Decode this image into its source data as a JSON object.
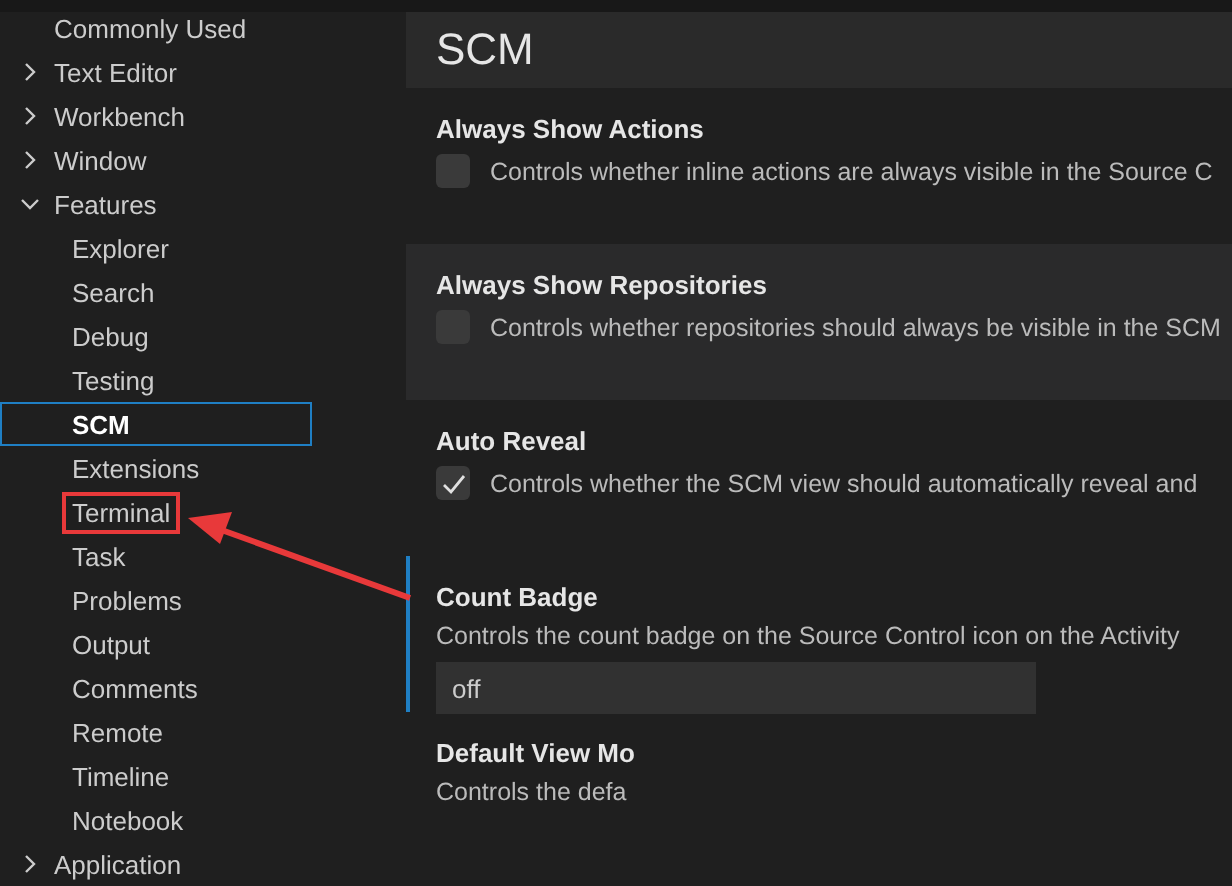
{
  "sidebar": {
    "items": [
      {
        "label": "Commonly Used",
        "kind": "link",
        "selected": false
      },
      {
        "label": "Text Editor",
        "kind": "group",
        "expanded": false,
        "selected": false
      },
      {
        "label": "Workbench",
        "kind": "group",
        "expanded": false,
        "selected": false
      },
      {
        "label": "Window",
        "kind": "group",
        "expanded": false,
        "selected": false
      },
      {
        "label": "Features",
        "kind": "group",
        "expanded": true,
        "selected": false,
        "children": [
          {
            "label": "Explorer",
            "selected": false,
            "highlighted": false
          },
          {
            "label": "Search",
            "selected": false,
            "highlighted": false
          },
          {
            "label": "Debug",
            "selected": false,
            "highlighted": false
          },
          {
            "label": "Testing",
            "selected": false,
            "highlighted": false
          },
          {
            "label": "SCM",
            "selected": true,
            "highlighted": false
          },
          {
            "label": "Extensions",
            "selected": false,
            "highlighted": false
          },
          {
            "label": "Terminal",
            "selected": false,
            "highlighted": true
          },
          {
            "label": "Task",
            "selected": false,
            "highlighted": false
          },
          {
            "label": "Problems",
            "selected": false,
            "highlighted": false
          },
          {
            "label": "Output",
            "selected": false,
            "highlighted": false
          },
          {
            "label": "Comments",
            "selected": false,
            "highlighted": false
          },
          {
            "label": "Remote",
            "selected": false,
            "highlighted": false
          },
          {
            "label": "Timeline",
            "selected": false,
            "highlighted": false
          },
          {
            "label": "Notebook",
            "selected": false,
            "highlighted": false
          }
        ]
      },
      {
        "label": "Application",
        "kind": "group",
        "expanded": false,
        "selected": false
      }
    ]
  },
  "section": {
    "title": "SCM"
  },
  "settings": [
    {
      "title": "Always Show Actions",
      "kind": "checkbox",
      "checked": false,
      "hovered": false,
      "focused": false,
      "description": "Controls whether inline actions are always visible in the Source C"
    },
    {
      "title": "Always Show Repositories",
      "kind": "checkbox",
      "checked": false,
      "hovered": true,
      "focused": false,
      "description": "Controls whether repositories should always be visible in the SCM"
    },
    {
      "title": "Auto Reveal",
      "kind": "checkbox",
      "checked": true,
      "hovered": false,
      "focused": false,
      "description": "Controls whether the SCM view should automatically reveal and"
    },
    {
      "title": "Count Badge",
      "kind": "dropdown",
      "hovered": false,
      "focused": true,
      "description": "Controls the count badge on the Source Control icon on the Activity",
      "value": "off"
    },
    {
      "title": "Default View Mo",
      "kind": "text",
      "hovered": false,
      "focused": false,
      "description": "Controls the defa"
    }
  ]
}
